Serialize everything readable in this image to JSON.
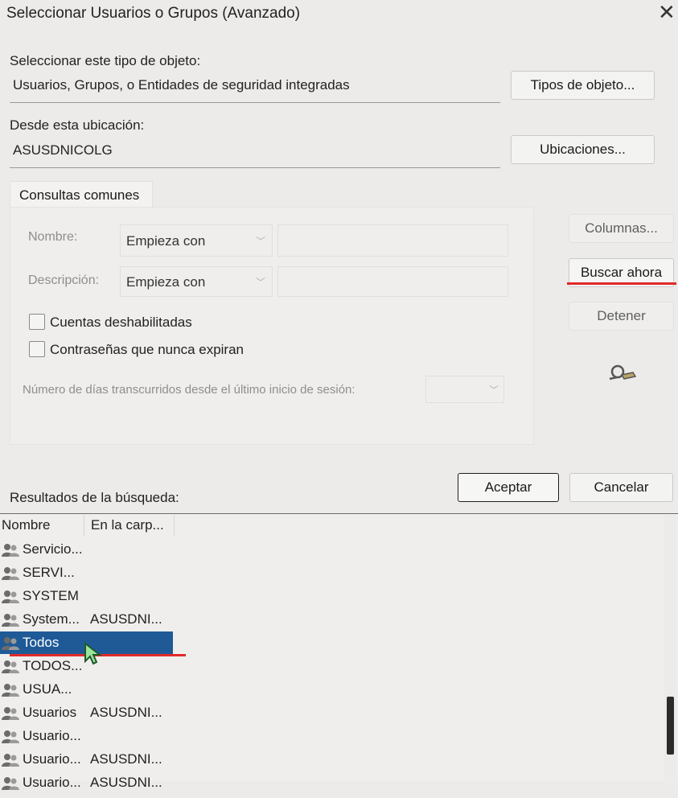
{
  "window": {
    "title": "Seleccionar Usuarios o Grupos (Avanzado)",
    "close_glyph": "✕"
  },
  "object_type": {
    "label": "Seleccionar este tipo de objeto:",
    "value": "Usuarios, Grupos, o Entidades de seguridad integradas",
    "button": "Tipos de objeto..."
  },
  "location": {
    "label": "Desde esta ubicación:",
    "value": "ASUSDNICOLG",
    "button": "Ubicaciones..."
  },
  "tab": {
    "label": "Consultas comunes"
  },
  "query": {
    "name_label": "Nombre:",
    "name_operator": "Empieza con",
    "desc_label": "Descripción:",
    "desc_operator": "Empieza con",
    "disabled_accounts": "Cuentas deshabilitadas",
    "non_expiring": "Contraseñas que nunca expiran",
    "days_label": "Número de días transcurridos desde el último inicio de sesión:"
  },
  "side_buttons": {
    "columns": "Columnas...",
    "search_now": "Buscar ahora",
    "stop": "Detener"
  },
  "dialog_buttons": {
    "ok": "Aceptar",
    "cancel": "Cancelar"
  },
  "results": {
    "label": "Resultados de la búsqueda:",
    "columns": [
      "Nombre",
      "En la carp..."
    ],
    "rows": [
      {
        "name": "Servicio...",
        "folder": ""
      },
      {
        "name": "SERVI...",
        "folder": ""
      },
      {
        "name": "SYSTEM",
        "folder": ""
      },
      {
        "name": "System...",
        "folder": "ASUSDNI..."
      },
      {
        "name": "Todos",
        "folder": ""
      },
      {
        "name": "TODOS...",
        "folder": ""
      },
      {
        "name": "USUA...",
        "folder": ""
      },
      {
        "name": "Usuarios",
        "folder": "ASUSDNI..."
      },
      {
        "name": "Usuario...",
        "folder": ""
      },
      {
        "name": "Usuario...",
        "folder": "ASUSDNI..."
      },
      {
        "name": "Usuario...",
        "folder": "ASUSDNI..."
      }
    ],
    "selected_row": "Todos"
  },
  "colors": {
    "selection": "#1f5a97",
    "annotation_underline": "#e02a2a"
  },
  "icons": {
    "group": "group-users-icon",
    "search_person": "search-person-icon",
    "cursor": "mouse-cursor-icon"
  }
}
